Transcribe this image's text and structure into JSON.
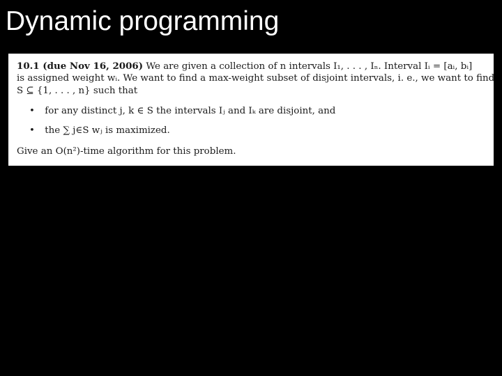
{
  "slide": {
    "title": "Dynamic programming",
    "background_color": "#000000",
    "title_color": "#ffffff"
  },
  "problem": {
    "label": "10.1 (due Nov 16, 2006)",
    "line1_text": "We are given a collection of n intervals I₁, . . . , Iₙ.  Interval Iᵢ = [aᵢ, bᵢ]",
    "line2_text": "is assigned weight wᵢ.  We want to find a max-weight subset of disjoint intervals, i. e., we want to find",
    "line3_text": "S ⊆ {1, . . . , n} such that",
    "bullets": [
      "for any distinct j, k ∈ S the intervals Iⱼ and Iₖ are disjoint, and",
      "the ∑ j∈S wⱼ is maximized."
    ],
    "closing": "Give an O(n²)-time algorithm for this problem.",
    "box_color": "#ffffff"
  }
}
